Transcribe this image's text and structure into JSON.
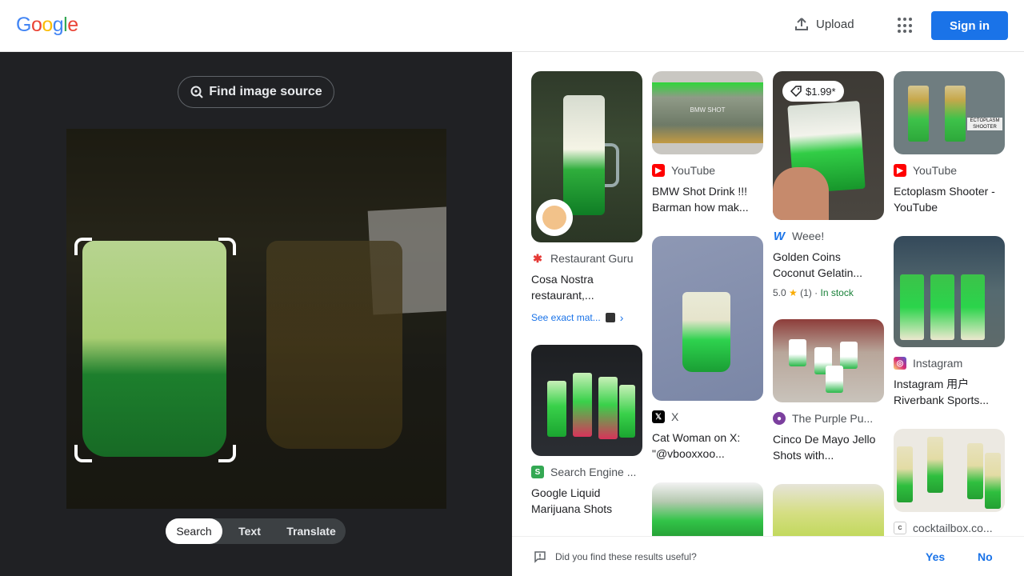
{
  "header": {
    "logo": [
      "G",
      "o",
      "o",
      "g",
      "l",
      "e"
    ],
    "logo_colors": [
      "#4285f4",
      "#ea4335",
      "#fbbc05",
      "#4285f4",
      "#34a853",
      "#ea4335"
    ],
    "upload_label": "Upload",
    "signin_label": "Sign in"
  },
  "left": {
    "find_source_label": "Find image source",
    "modes": [
      "Search",
      "Text",
      "Translate"
    ],
    "active_mode": "Search"
  },
  "results": [
    {
      "source": "Restaurant Guru",
      "title": "Cosa Nostra restaurant,...",
      "see_exact": "See exact mat...",
      "icon": "restaurant-guru-icon"
    },
    {
      "source": "Search Engine ...",
      "title": "Google Liquid Marijuana Shots",
      "icon": "search-engine-icon"
    },
    {
      "source": "YouTube",
      "title": "BMW Shot Drink !!! Barman how mak...",
      "thumb_text": "BMW SHOT",
      "icon": "youtube-icon"
    },
    {
      "source": "X",
      "title": "Cat Woman on X: \"@vbooxxoo...",
      "icon": "x-icon"
    },
    {
      "source": "Weee!",
      "title": "Golden Coins Coconut Gelatin...",
      "price": "$1.99*",
      "rating": "5.0",
      "reviews": "(1)",
      "stock": "In stock",
      "icon": "weee-icon"
    },
    {
      "source": "The Purple Pu...",
      "title": "Cinco De Mayo Jello Shots with...",
      "icon": "purple-pumpkin-icon"
    },
    {
      "source": "YouTube",
      "title": "Ectoplasm Shooter - YouTube",
      "thumb_text": "ECTOPLASM SHOOTER",
      "icon": "youtube-icon"
    },
    {
      "source": "Instagram",
      "title": "Instagram 用户 Riverbank Sports...",
      "icon": "instagram-icon"
    },
    {
      "source": "cocktailbox.co...",
      "icon": "cocktailbox-icon"
    }
  ],
  "feedback": {
    "question": "Did you find these results useful?",
    "yes": "Yes",
    "no": "No"
  }
}
